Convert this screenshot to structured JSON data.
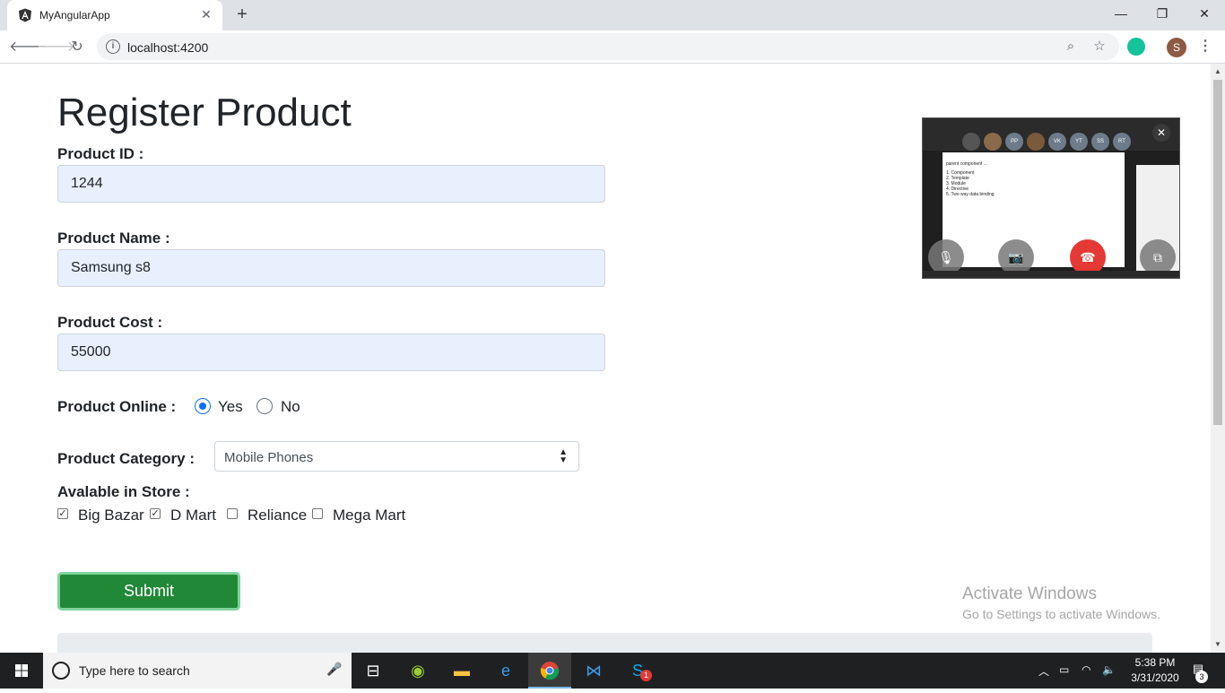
{
  "browser": {
    "tab_title": "MyAngularApp",
    "tab_close": "✕",
    "new_tab": "+",
    "url": "localhost:4200",
    "profile_initial": "S"
  },
  "page": {
    "title": "Register Product",
    "product_id": {
      "label": "Product ID :",
      "value": "1244"
    },
    "product_name": {
      "label": "Product Name :",
      "value": "Samsung s8"
    },
    "product_cost": {
      "label": "Product Cost :",
      "value": "55000"
    },
    "product_online": {
      "label": "Product Online :",
      "options": [
        {
          "label": "Yes",
          "checked": true
        },
        {
          "label": "No",
          "checked": false
        }
      ]
    },
    "product_category": {
      "label": "Product Category :",
      "selected": "Mobile Phones"
    },
    "available_in_store": {
      "label": "Avalable in Store :",
      "stores": [
        {
          "label": "Big Bazar",
          "checked": true
        },
        {
          "label": "D Mart",
          "checked": true
        },
        {
          "label": "Reliance",
          "checked": false
        },
        {
          "label": "Mega Mart",
          "checked": false
        }
      ]
    },
    "submit_label": "Submit"
  },
  "watermark": {
    "title": "Activate Windows",
    "subtitle": "Go to Settings to activate Windows."
  },
  "video_call": {
    "participants": [
      "PP",
      "VK",
      "YT",
      "SS",
      "RT"
    ],
    "shared_screen_lines": [
      "parent component ...",
      "1. Component",
      "2. Template",
      "3. Module",
      "4. Directive",
      "5. Two way data binding"
    ]
  },
  "taskbar": {
    "search_placeholder": "Type here to search",
    "time": "5:38 PM",
    "date": "3/31/2020",
    "notification_count": "3",
    "skype_badge": "1"
  },
  "colors": {
    "submit_bg": "#218838",
    "radio_accent": "#0d6efd",
    "input_bg": "#e8f0fe"
  }
}
